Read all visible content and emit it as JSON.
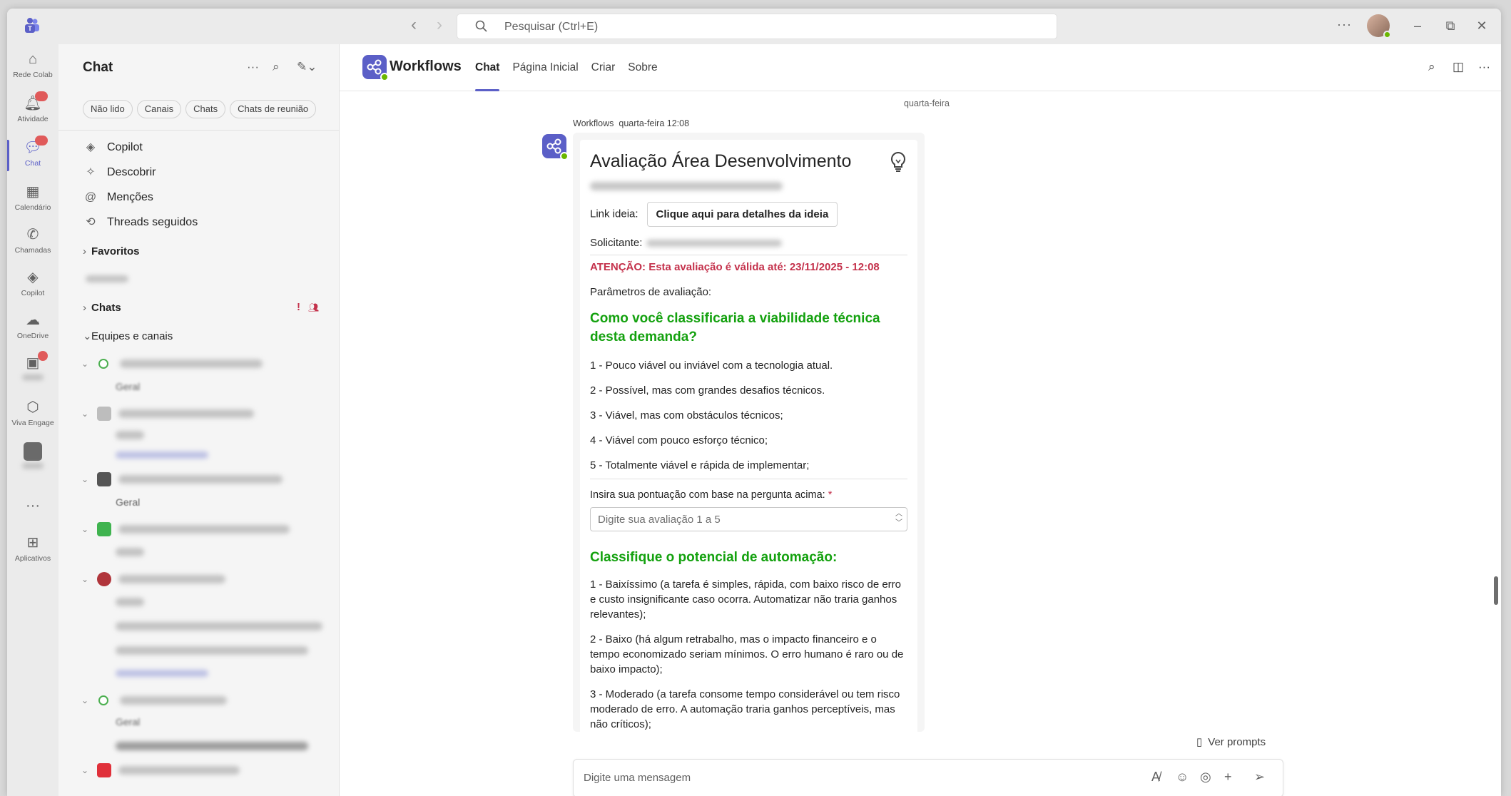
{
  "titlebar": {
    "search_placeholder": "Pesquisar (Ctrl+E)",
    "more": "···"
  },
  "rail": [
    {
      "label": "Rede Colab",
      "icon": "home-icon"
    },
    {
      "label": "Atividade",
      "icon": "bell-icon"
    },
    {
      "label": "Chat",
      "icon": "chat-icon"
    },
    {
      "label": "Calendário",
      "icon": "calendar-icon"
    },
    {
      "label": "Chamadas",
      "icon": "phone-icon"
    },
    {
      "label": "Copilot",
      "icon": "copilot-icon"
    },
    {
      "label": "OneDrive",
      "icon": "cloud-icon"
    },
    {
      "label": "Viva Engage",
      "icon": "engage-icon"
    },
    {
      "label": "Aplicativos",
      "icon": "apps-icon"
    }
  ],
  "chatpane": {
    "title": "Chat",
    "filters": [
      "Não lido",
      "Canais",
      "Chats",
      "Chats de reunião"
    ],
    "nav": [
      "Copilot",
      "Descobrir",
      "Menções",
      "Threads seguidos"
    ],
    "sections": {
      "favoritos": "Favoritos",
      "chats": "Chats",
      "equipes": "Equipes e canais"
    },
    "teams": [
      {
        "sub": "Geral"
      },
      {
        "sub": "Geral"
      },
      {
        "sub": "Geral"
      },
      {
        "sub": ""
      },
      {
        "sub": "Geral"
      }
    ]
  },
  "header": {
    "title": "Workflows",
    "tabs": [
      "Chat",
      "Página Inicial",
      "Criar",
      "Sobre"
    ]
  },
  "conversation": {
    "day_label": "quarta-feira",
    "sender": "Workflows",
    "time": "quarta-feira 12:08"
  },
  "card": {
    "title": "Avaliação Área Desenvolvimento",
    "link_label": "Link ideia:",
    "link_button": "Clique aqui para detalhes da ideia",
    "requester_label": "Solicitante:",
    "warning": "ATENÇÃO: Esta avaliação é válida até: 23/11/2025 - 12:08",
    "params_label": "Parâmetros de avaliação:",
    "q1": "Como você classificaria a viabilidade técnica desta demanda?",
    "q1_options": [
      "1 - Pouco viável ou inviável com a tecnologia atual.",
      "2 - Possível, mas com grandes desafios técnicos.",
      "3 - Viável, mas com obstáculos técnicos;",
      "4 - Viável com pouco esforço técnico;",
      "5 - Totalmente viável e rápida de implementar;"
    ],
    "score_label": "Insira sua pontuação com base na pergunta acima:",
    "required_mark": "*",
    "score_placeholder": "Digite sua avaliação 1 a 5",
    "q2": "Classifique o potencial de automação:",
    "q2_options": [
      "1 - Baixíssimo (a tarefa é simples, rápida, com baixo risco de erro e custo insignificante caso ocorra. Automatizar não traria ganhos relevantes);",
      "2 - Baixo (há algum retrabalho, mas o impacto financeiro e o tempo economizado seriam mínimos. O erro humano é raro ou de baixo impacto);",
      "3 - Moderado (a tarefa consome tempo considerável ou tem risco moderado de erro. A automação traria ganhos perceptíveis, mas não críticos);"
    ]
  },
  "compose": {
    "prompts": "Ver prompts",
    "placeholder": "Digite uma mensagem"
  },
  "colors": {
    "brand": "#5b5fc7",
    "warning": "#c4314b",
    "question": "#13a10e"
  }
}
